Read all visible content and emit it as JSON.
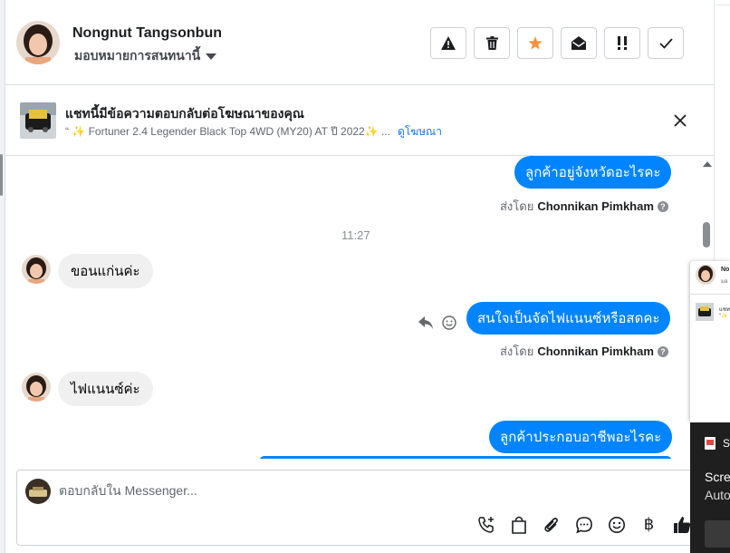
{
  "colors": {
    "brand": "#0084ff",
    "accent_star": "#f7923a",
    "link": "#1877f2"
  },
  "header": {
    "name": "Nongnut Tangsonbun",
    "assign_label": "มอบหมายการสนทนานี้",
    "actions": [
      {
        "icon": "warning-icon"
      },
      {
        "icon": "trash-icon"
      },
      {
        "icon": "star-icon"
      },
      {
        "icon": "open-envelope-icon"
      },
      {
        "icon": "exclamation-icon"
      },
      {
        "icon": "checkmark-icon"
      }
    ]
  },
  "ad": {
    "title": "แชทนี้มีข้อความตอบกลับต่อโฆษณาของคุณ",
    "quote": "“ ✨ Fortuner 2.4 Legender Black Top 4WD (MY20) AT ปี 2022✨ ...",
    "link": "ดูโฆษณา"
  },
  "chat": {
    "messages": [
      {
        "from": "page",
        "text": "ลูกค้าอยู่จังหวัดอะไรคะ",
        "sent_by_prefix": "ส่งโดย",
        "sent_by_name": "Chonnikan Pimkham"
      },
      {
        "timestamp": "11:27"
      },
      {
        "from": "customer",
        "text": "ขอนแก่นค่ะ"
      },
      {
        "from": "page",
        "text": "สนใจเป็นจัดไฟแนนซ์หรือสดคะ",
        "sent_by_prefix": "ส่งโดย",
        "sent_by_name": "Chonnikan Pimkham"
      },
      {
        "from": "customer",
        "text": "ไฟแนนซ์ค่ะ"
      },
      {
        "from": "page",
        "text": "ลูกค้าประกอบอาชีพอะไรคะ"
      }
    ]
  },
  "composer": {
    "placeholder": "ตอบกลับใน Messenger...",
    "tools": [
      "phone-add-icon",
      "shopping-bag-icon",
      "paperclip-icon",
      "chat-bubble-icon",
      "emoji-icon",
      "baht-icon",
      "thumbs-up-icon"
    ],
    "baht_symbol": "฿"
  },
  "popup": {
    "name": "No",
    "sub": "มอ",
    "ad_line1": "แชท",
    "ad_line2": "“✨"
  },
  "toast": {
    "app": "S",
    "line1": "Scree",
    "line2": "Auto"
  }
}
